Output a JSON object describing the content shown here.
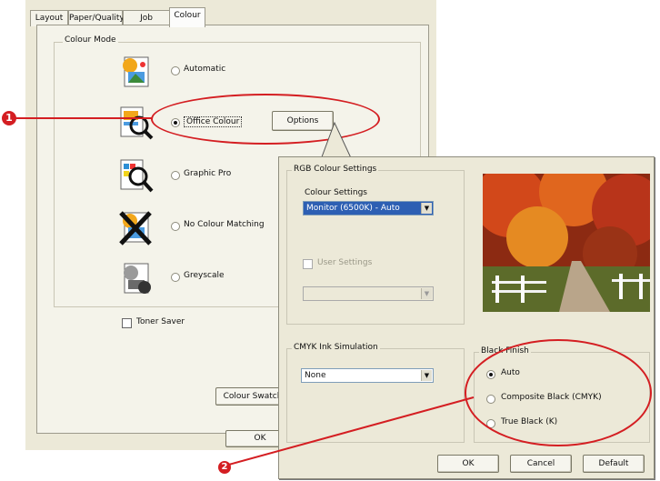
{
  "tabs": [
    "Layout",
    "Paper/Quality",
    "Job Options",
    "Colour"
  ],
  "colour_mode": {
    "label": "Colour Mode",
    "options": [
      {
        "label": "Automatic",
        "selected": false,
        "icon": "automatic-colour-icon"
      },
      {
        "label": "Office Colour",
        "selected": true,
        "icon": "office-colour-icon"
      },
      {
        "label": "Graphic Pro",
        "selected": false,
        "icon": "graphic-pro-icon"
      },
      {
        "label": "No Colour Matching",
        "selected": false,
        "icon": "no-colour-matching-icon"
      },
      {
        "label": "Greyscale",
        "selected": false,
        "icon": "greyscale-icon"
      }
    ],
    "options_button": "Options"
  },
  "toner_saver": {
    "label": "Toner Saver",
    "checked": false
  },
  "colour_swatch_button": "Colour Swatch",
  "ok_button": "OK",
  "callouts": [
    "1",
    "2"
  ],
  "accent_color": "#d41e22",
  "dialog": {
    "rgb_group_label": "RGB Colour Settings",
    "colour_settings_label": "Colour Settings",
    "colour_settings_value": "Monitor (6500K) - Auto",
    "user_settings_label": "User Settings",
    "user_settings_checked": false,
    "user_settings_value": "",
    "cmyk_group_label": "CMYK Ink Simulation",
    "cmyk_value": "None",
    "black_finish_label": "Black Finish",
    "black_options": [
      {
        "label": "Auto",
        "selected": true
      },
      {
        "label": "Composite Black (CMYK)",
        "selected": false
      },
      {
        "label": "True Black (K)",
        "selected": false
      }
    ],
    "ok_button": "OK",
    "cancel_button": "Cancel",
    "default_button": "Default",
    "preview_image": "autumn-road-photo"
  }
}
